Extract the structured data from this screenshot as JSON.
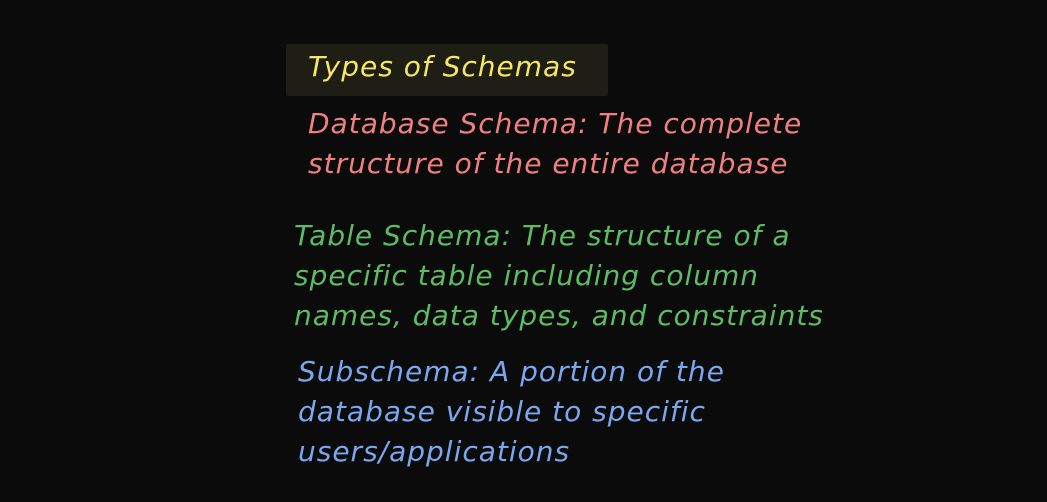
{
  "slide": {
    "title": "Types of Schemas",
    "colors": {
      "background": "#0b0b0b",
      "title": "#f5e663",
      "database_schema": "#f08080",
      "table_schema": "#5dbb63",
      "subschema": "#7aa7f0"
    },
    "database_schema": {
      "lines": [
        "Database Schema: The complete",
        "structure of the entire database"
      ]
    },
    "table_schema": {
      "lines": [
        "Table Schema: The structure of a",
        "specific table including column",
        "names, data types, and constraints"
      ]
    },
    "subschema": {
      "lines": [
        "Subschema: A portion of the",
        "database visible to specific",
        "users/applications"
      ]
    }
  }
}
